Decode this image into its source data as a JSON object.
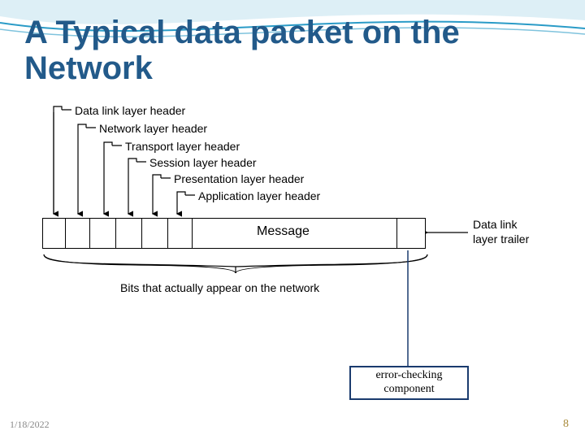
{
  "title": "A Typical data packet on the Network",
  "headers": [
    "Data link layer header",
    "Network layer header",
    "Transport layer header",
    "Session layer header",
    "Presentation layer header",
    "Application layer header"
  ],
  "message_label": "Message",
  "trailer_label": "Data link\nlayer trailer",
  "bits_label": "Bits that actually appear on the network",
  "callout": {
    "line1": "error-checking",
    "line2": "component"
  },
  "footer": {
    "date": "1/18/2022",
    "page": "8"
  }
}
